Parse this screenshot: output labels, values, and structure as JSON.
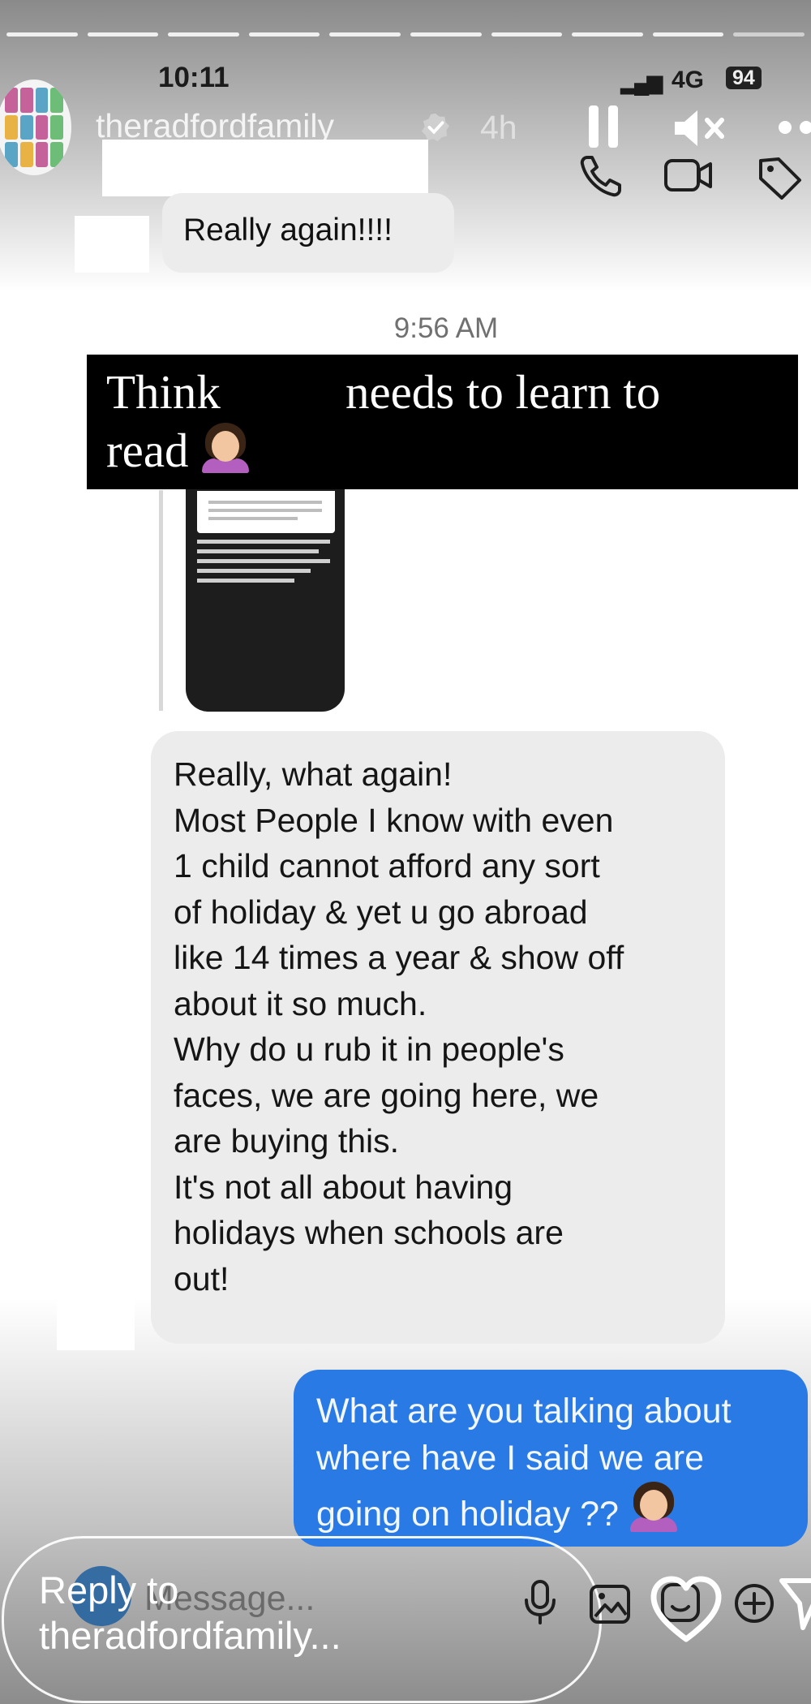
{
  "status_bar": {
    "time": "10:11",
    "signal": "▂▄▆",
    "network": "4G",
    "battery": "94"
  },
  "story_header": {
    "username": "theradfordfamily",
    "posted": "4h"
  },
  "thread": {
    "first_message": "Really again!!!!",
    "timestamp": "9:56 AM",
    "caption_part1": "Think",
    "caption_part2": "needs to learn to",
    "caption_part3": "read",
    "incoming_lines": [
      "Really, what again!",
      "Most People I know with even",
      "1 child cannot afford any sort",
      "of holiday & yet u go abroad",
      "like 14 times a year & show off",
      "about it so much.",
      "Why do u rub it in people's",
      "faces, we are going here, we",
      "are buying this.",
      "It's not all about having",
      "holidays when schools are",
      "out!"
    ],
    "outgoing_lines": [
      "What are you talking about",
      "where have I said we are",
      "going on holiday ??"
    ]
  },
  "reply_bar": {
    "label_line1": "Reply to",
    "label_line2": "theradfordfamily...",
    "message_placeholder": "Message..."
  },
  "colors": {
    "outgoing_bubble": "#2a7ae6",
    "incoming_bubble": "#ececec",
    "caption_bg": "#000000"
  },
  "icons": [
    "verified-icon",
    "pause-icon",
    "mute-icon",
    "more-icon",
    "phone-icon",
    "video-icon",
    "tag-icon",
    "mic-icon",
    "gallery-icon",
    "sticker-icon",
    "heart-icon",
    "plus-icon",
    "send-icon",
    "facepalm-emoji"
  ]
}
